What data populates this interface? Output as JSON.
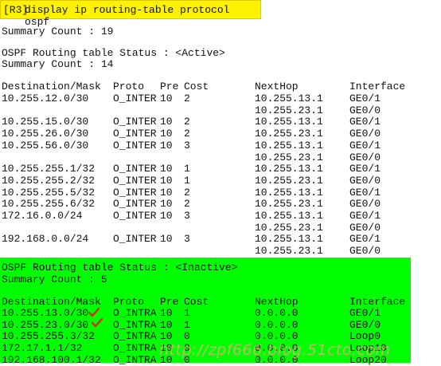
{
  "command": {
    "prompt": "[R3]",
    "text": "display ip routing-table protocol ospf"
  },
  "summary_count_line": "Summary Count : 19",
  "active": {
    "status_line": "OSPF Routing table Status : <Active>",
    "count_line": "Summary Count : 14",
    "headers": {
      "dest": "Destination/Mask",
      "proto": "Proto",
      "pre": "Pre",
      "cost": "Cost",
      "nexthop": "NextHop",
      "iface": "Interface"
    },
    "rows": [
      {
        "dest": "10.255.12.0/30",
        "proto": "O_INTER",
        "pre": "10",
        "cost": "2",
        "nexthop": "10.255.13.1",
        "iface": "GE0/1"
      },
      {
        "dest": "",
        "proto": "",
        "pre": "",
        "cost": "",
        "nexthop": "10.255.23.1",
        "iface": "GE0/0"
      },
      {
        "dest": "10.255.15.0/30",
        "proto": "O_INTER",
        "pre": "10",
        "cost": "2",
        "nexthop": "10.255.13.1",
        "iface": "GE0/1"
      },
      {
        "dest": "10.255.26.0/30",
        "proto": "O_INTER",
        "pre": "10",
        "cost": "2",
        "nexthop": "10.255.23.1",
        "iface": "GE0/0"
      },
      {
        "dest": "10.255.56.0/30",
        "proto": "O_INTER",
        "pre": "10",
        "cost": "3",
        "nexthop": "10.255.13.1",
        "iface": "GE0/1"
      },
      {
        "dest": "",
        "proto": "",
        "pre": "",
        "cost": "",
        "nexthop": "10.255.23.1",
        "iface": "GE0/0"
      },
      {
        "dest": "10.255.255.1/32",
        "proto": "O_INTER",
        "pre": "10",
        "cost": "1",
        "nexthop": "10.255.13.1",
        "iface": "GE0/1"
      },
      {
        "dest": "10.255.255.2/32",
        "proto": "O_INTER",
        "pre": "10",
        "cost": "1",
        "nexthop": "10.255.23.1",
        "iface": "GE0/0"
      },
      {
        "dest": "10.255.255.5/32",
        "proto": "O_INTER",
        "pre": "10",
        "cost": "2",
        "nexthop": "10.255.13.1",
        "iface": "GE0/1"
      },
      {
        "dest": "10.255.255.6/32",
        "proto": "O_INTER",
        "pre": "10",
        "cost": "2",
        "nexthop": "10.255.23.1",
        "iface": "GE0/0"
      },
      {
        "dest": "172.16.0.0/24",
        "proto": "O_INTER",
        "pre": "10",
        "cost": "3",
        "nexthop": "10.255.13.1",
        "iface": "GE0/1"
      },
      {
        "dest": "",
        "proto": "",
        "pre": "",
        "cost": "",
        "nexthop": "10.255.23.1",
        "iface": "GE0/0"
      },
      {
        "dest": "192.168.0.0/24",
        "proto": "O_INTER",
        "pre": "10",
        "cost": "3",
        "nexthop": "10.255.13.1",
        "iface": "GE0/1"
      },
      {
        "dest": "",
        "proto": "",
        "pre": "",
        "cost": "",
        "nexthop": "10.255.23.1",
        "iface": "GE0/0"
      }
    ]
  },
  "inactive": {
    "status_line": "OSPF Routing table Status : <Inactive>",
    "count_line": "Summary Count : 5",
    "rows": [
      {
        "dest": "10.255.13.0/30",
        "proto": "O_INTRA",
        "pre": "10",
        "cost": "1",
        "nexthop": "0.0.0.0",
        "iface": "GE0/1"
      },
      {
        "dest": "10.255.23.0/30",
        "proto": "O_INTRA",
        "pre": "10",
        "cost": "1",
        "nexthop": "0.0.0.0",
        "iface": "GE0/0"
      },
      {
        "dest": "10.255.255.3/32",
        "proto": "O_INTRA",
        "pre": "10",
        "cost": "0",
        "nexthop": "0.0.0.0",
        "iface": "Loop0"
      },
      {
        "dest": "172.17.1.1/32",
        "proto": "O_INTRA",
        "pre": "10",
        "cost": "0",
        "nexthop": "0.0.0.0",
        "iface": "Loop10"
      },
      {
        "dest": "192.168.100.1/32",
        "proto": "O_INTRA",
        "pre": "10",
        "cost": "0",
        "nexthop": "0.0.0.0",
        "iface": "Loop20"
      }
    ]
  },
  "watermark": "http://zpf666.blog.51cto.com",
  "colors": {
    "command_highlight": "#fff200",
    "inactive_highlight": "#00ff00",
    "checkmark": "#cc3300",
    "watermark": "#ffa08c"
  }
}
